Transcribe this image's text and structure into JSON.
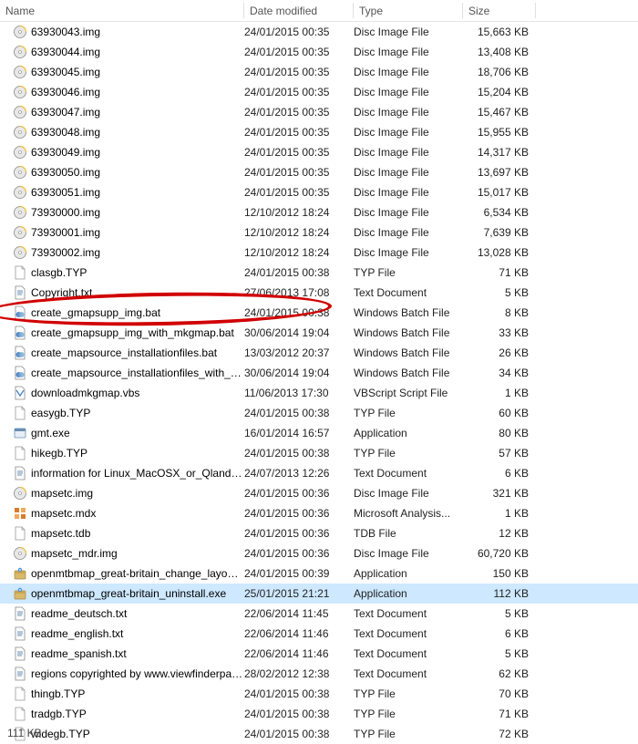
{
  "columns": {
    "name": "Name",
    "date": "Date modified",
    "type": "Type",
    "size": "Size"
  },
  "statusbar": "111 KB",
  "files": [
    {
      "icon": "img",
      "name": "63930043.img",
      "date": "24/01/2015 00:35",
      "type": "Disc Image File",
      "size": "15,663 KB"
    },
    {
      "icon": "img",
      "name": "63930044.img",
      "date": "24/01/2015 00:35",
      "type": "Disc Image File",
      "size": "13,408 KB"
    },
    {
      "icon": "img",
      "name": "63930045.img",
      "date": "24/01/2015 00:35",
      "type": "Disc Image File",
      "size": "18,706 KB"
    },
    {
      "icon": "img",
      "name": "63930046.img",
      "date": "24/01/2015 00:35",
      "type": "Disc Image File",
      "size": "15,204 KB"
    },
    {
      "icon": "img",
      "name": "63930047.img",
      "date": "24/01/2015 00:35",
      "type": "Disc Image File",
      "size": "15,467 KB"
    },
    {
      "icon": "img",
      "name": "63930048.img",
      "date": "24/01/2015 00:35",
      "type": "Disc Image File",
      "size": "15,955 KB"
    },
    {
      "icon": "img",
      "name": "63930049.img",
      "date": "24/01/2015 00:35",
      "type": "Disc Image File",
      "size": "14,317 KB"
    },
    {
      "icon": "img",
      "name": "63930050.img",
      "date": "24/01/2015 00:35",
      "type": "Disc Image File",
      "size": "13,697 KB"
    },
    {
      "icon": "img",
      "name": "63930051.img",
      "date": "24/01/2015 00:35",
      "type": "Disc Image File",
      "size": "15,017 KB"
    },
    {
      "icon": "img",
      "name": "73930000.img",
      "date": "12/10/2012 18:24",
      "type": "Disc Image File",
      "size": "6,534 KB"
    },
    {
      "icon": "img",
      "name": "73930001.img",
      "date": "12/10/2012 18:24",
      "type": "Disc Image File",
      "size": "7,639 KB"
    },
    {
      "icon": "img",
      "name": "73930002.img",
      "date": "12/10/2012 18:24",
      "type": "Disc Image File",
      "size": "13,028 KB"
    },
    {
      "icon": "file",
      "name": "clasgb.TYP",
      "date": "24/01/2015 00:38",
      "type": "TYP File",
      "size": "71 KB"
    },
    {
      "icon": "txt",
      "name": "Copyright.txt",
      "date": "27/06/2013 17:08",
      "type": "Text Document",
      "size": "5 KB"
    },
    {
      "icon": "bat",
      "name": "create_gmapsupp_img.bat",
      "date": "24/01/2015 00:38",
      "type": "Windows Batch File",
      "size": "8 KB",
      "highlight": true
    },
    {
      "icon": "bat",
      "name": "create_gmapsupp_img_with_mkgmap.bat",
      "date": "30/06/2014 19:04",
      "type": "Windows Batch File",
      "size": "33 KB"
    },
    {
      "icon": "bat",
      "name": "create_mapsource_installationfiles.bat",
      "date": "13/03/2012 20:37",
      "type": "Windows Batch File",
      "size": "26 KB"
    },
    {
      "icon": "bat",
      "name": "create_mapsource_installationfiles_with_mkgmap.bat",
      "date": "30/06/2014 19:04",
      "type": "Windows Batch File",
      "size": "34 KB"
    },
    {
      "icon": "vbs",
      "name": "downloadmkgmap.vbs",
      "date": "11/06/2013 17:30",
      "type": "VBScript Script File",
      "size": "1 KB"
    },
    {
      "icon": "file",
      "name": "easygb.TYP",
      "date": "24/01/2015 00:38",
      "type": "TYP File",
      "size": "60 KB"
    },
    {
      "icon": "exe",
      "name": "gmt.exe",
      "date": "16/01/2014 16:57",
      "type": "Application",
      "size": "80 KB"
    },
    {
      "icon": "file",
      "name": "hikegb.TYP",
      "date": "24/01/2015 00:38",
      "type": "TYP File",
      "size": "57 KB"
    },
    {
      "icon": "txt",
      "name": "information for Linux_MacOSX_or_Qlandkarte_users.txt",
      "date": "24/07/2013 12:26",
      "type": "Text Document",
      "size": "6 KB"
    },
    {
      "icon": "img",
      "name": "mapsetc.img",
      "date": "24/01/2015 00:36",
      "type": "Disc Image File",
      "size": "321 KB"
    },
    {
      "icon": "mdx",
      "name": "mapsetc.mdx",
      "date": "24/01/2015 00:36",
      "type": "Microsoft Analysis...",
      "size": "1 KB"
    },
    {
      "icon": "file",
      "name": "mapsetc.tdb",
      "date": "24/01/2015 00:36",
      "type": "TDB File",
      "size": "12 KB"
    },
    {
      "icon": "img",
      "name": "mapsetc_mdr.img",
      "date": "24/01/2015 00:36",
      "type": "Disc Image File",
      "size": "60,720 KB"
    },
    {
      "icon": "setup",
      "name": "openmtbmap_great-britain_change_layout.exe",
      "date": "24/01/2015 00:39",
      "type": "Application",
      "size": "150 KB"
    },
    {
      "icon": "setup",
      "name": "openmtbmap_great-britain_uninstall.exe",
      "date": "25/01/2015 21:21",
      "type": "Application",
      "size": "112 KB",
      "selected": true
    },
    {
      "icon": "txt",
      "name": "readme_deutsch.txt",
      "date": "22/06/2014 11:45",
      "type": "Text Document",
      "size": "5 KB"
    },
    {
      "icon": "txt",
      "name": "readme_english.txt",
      "date": "22/06/2014 11:46",
      "type": "Text Document",
      "size": "6 KB"
    },
    {
      "icon": "txt",
      "name": "readme_spanish.txt",
      "date": "22/06/2014 11:46",
      "type": "Text Document",
      "size": "5 KB"
    },
    {
      "icon": "txt",
      "name": "regions copyrighted by www.viewfinderpanoramas.org.txt",
      "date": "28/02/2012 12:38",
      "type": "Text Document",
      "size": "62 KB"
    },
    {
      "icon": "file",
      "name": "thingb.TYP",
      "date": "24/01/2015 00:38",
      "type": "TYP File",
      "size": "70 KB"
    },
    {
      "icon": "file",
      "name": "tradgb.TYP",
      "date": "24/01/2015 00:38",
      "type": "TYP File",
      "size": "71 KB"
    },
    {
      "icon": "file",
      "name": "widegb.TYP",
      "date": "24/01/2015 00:38",
      "type": "TYP File",
      "size": "72 KB"
    }
  ],
  "icons": {
    "img": "disc-image-icon",
    "file": "generic-file-icon",
    "txt": "text-file-icon",
    "bat": "batch-file-icon",
    "vbs": "script-file-icon",
    "exe": "application-icon",
    "mdx": "analysis-file-icon",
    "setup": "installer-icon"
  }
}
